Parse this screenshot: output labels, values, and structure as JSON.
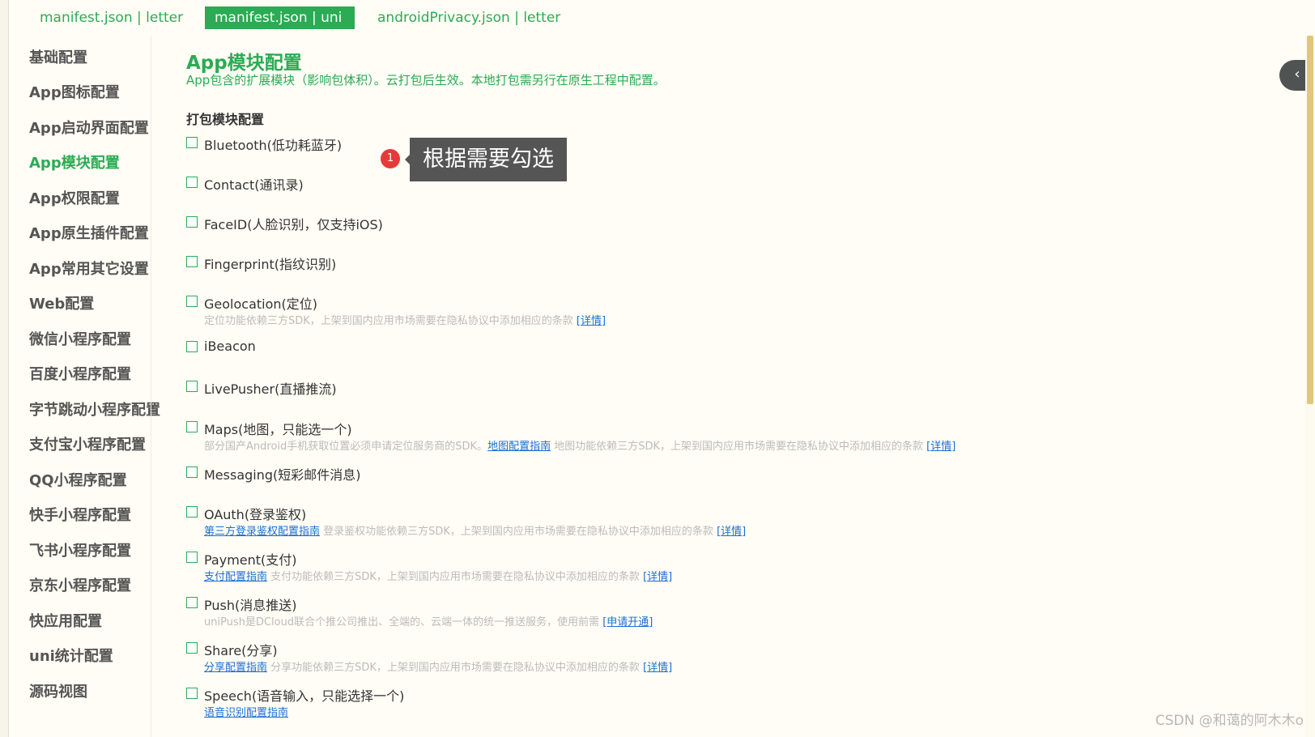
{
  "tabs": [
    {
      "label": "manifest.json | letter"
    },
    {
      "label": "manifest.json | uni"
    },
    {
      "label": "androidPrivacy.json | letter"
    }
  ],
  "sidebar": {
    "items": [
      {
        "label": "基础配置"
      },
      {
        "label": "App图标配置"
      },
      {
        "label": "App启动界面配置"
      },
      {
        "label": "App模块配置"
      },
      {
        "label": "App权限配置"
      },
      {
        "label": "App原生插件配置"
      },
      {
        "label": "App常用其它设置"
      },
      {
        "label": "Web配置"
      },
      {
        "label": "微信小程序配置"
      },
      {
        "label": "百度小程序配置"
      },
      {
        "label": "字节跳动小程序配置"
      },
      {
        "label": "支付宝小程序配置"
      },
      {
        "label": "QQ小程序配置"
      },
      {
        "label": "快手小程序配置"
      },
      {
        "label": "飞书小程序配置"
      },
      {
        "label": "京东小程序配置"
      },
      {
        "label": "快应用配置"
      },
      {
        "label": "uni统计配置"
      },
      {
        "label": "源码视图"
      }
    ]
  },
  "main": {
    "title": "App模块配置",
    "subtitle": "App包含的扩展模块（影响包体积）。云打包后生效。本地打包需另行在原生工程中配置。",
    "section_title": "打包模块配置",
    "modules": [
      {
        "label": "Bluetooth(低功耗蓝牙)"
      },
      {
        "label": "Contact(通讯录)"
      },
      {
        "label": "FaceID(人脸识别，仅支持iOS)"
      },
      {
        "label": "Fingerprint(指纹识别)"
      },
      {
        "label": "Geolocation(定位)",
        "desc_text": "定位功能依赖三方SDK，上架到国内应用市场需要在隐私协议中添加相应的条款 ",
        "desc_link": "[详情]"
      },
      {
        "label": "iBeacon"
      },
      {
        "label": "LivePusher(直播推流)"
      },
      {
        "label": "Maps(地图，只能选一个)",
        "desc_pre": "部分国产Android手机获取位置必须申请定位服务商的SDK。",
        "desc_link1": "地图配置指南",
        "desc_mid": " 地图功能依赖三方SDK，上架到国内应用市场需要在隐私协议中添加相应的条款 ",
        "desc_link2": "[详情]"
      },
      {
        "label": "Messaging(短彩邮件消息)"
      },
      {
        "label": "OAuth(登录鉴权)",
        "desc_link1": "第三方登录鉴权配置指南",
        "desc_mid": " 登录鉴权功能依赖三方SDK，上架到国内应用市场需要在隐私协议中添加相应的条款 ",
        "desc_link2": "[详情]"
      },
      {
        "label": "Payment(支付)",
        "desc_link1": "支付配置指南",
        "desc_mid": " 支付功能依赖三方SDK，上架到国内应用市场需要在隐私协议中添加相应的条款 ",
        "desc_link2": "[详情]"
      },
      {
        "label": "Push(消息推送)",
        "desc_text": "uniPush是DCloud联合个推公司推出、全端的、云端一体的统一推送服务，使用前需 ",
        "desc_link": "[申请开通]"
      },
      {
        "label": "Share(分享)",
        "desc_link1": "分享配置指南",
        "desc_mid": " 分享功能依赖三方SDK，上架到国内应用市场需要在隐私协议中添加相应的条款 ",
        "desc_link2": "[详情]"
      },
      {
        "label": "Speech(语音输入，只能选择一个)",
        "desc_link1": "语音识别配置指南"
      }
    ]
  },
  "callout": {
    "number": "1",
    "text": "根据需要勾选"
  },
  "collapse_button": {
    "glyph": "‹"
  },
  "watermark": "CSDN @和蔼的阿木木o",
  "colors": {
    "accent": "#2bab54",
    "link": "#1a6fd6",
    "callout_bg": "#555555",
    "badge": "#e63a3a",
    "scroll_thumb": "#e3c779"
  }
}
